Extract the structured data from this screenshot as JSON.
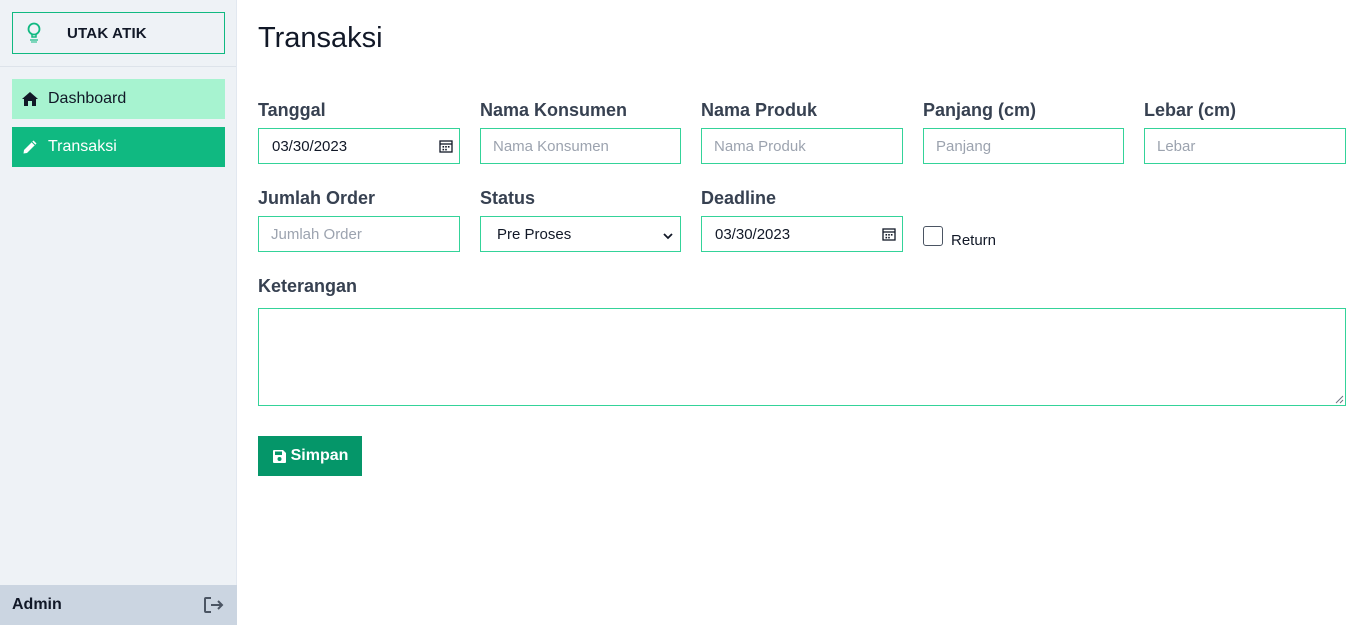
{
  "sidebar": {
    "brand": {
      "name": "UTAK ATIK",
      "logo_icon": "lightbulb-icon"
    },
    "items": [
      {
        "label": "Dashboard",
        "icon": "home-icon",
        "active": false
      },
      {
        "label": "Transaksi",
        "icon": "pencil-icon",
        "active": true
      }
    ],
    "footer": {
      "user": "Admin",
      "logout_icon": "logout-icon"
    }
  },
  "main": {
    "title": "Transaksi",
    "form": {
      "tanggal": {
        "label": "Tanggal",
        "value": "03/30/2023"
      },
      "nama_konsumen": {
        "label": "Nama Konsumen",
        "placeholder": "Nama Konsumen",
        "value": ""
      },
      "nama_produk": {
        "label": "Nama Produk",
        "placeholder": "Nama Produk",
        "value": ""
      },
      "panjang": {
        "label": "Panjang (cm)",
        "placeholder": "Panjang",
        "value": ""
      },
      "lebar": {
        "label": "Lebar (cm)",
        "placeholder": "Lebar",
        "value": ""
      },
      "jumlah_order": {
        "label": "Jumlah Order",
        "placeholder": "Jumlah Order",
        "value": ""
      },
      "status": {
        "label": "Status",
        "selected": "Pre Proses"
      },
      "deadline": {
        "label": "Deadline",
        "value": "03/30/2023"
      },
      "return": {
        "label": "Return",
        "checked": false
      },
      "keterangan": {
        "label": "Keterangan",
        "value": ""
      },
      "save_button": {
        "label": "Simpan",
        "icon": "save-icon"
      }
    }
  },
  "colors": {
    "accent": "#10b981",
    "accent_light": "#a7f3d0",
    "button": "#059669",
    "border": "#34d399"
  }
}
